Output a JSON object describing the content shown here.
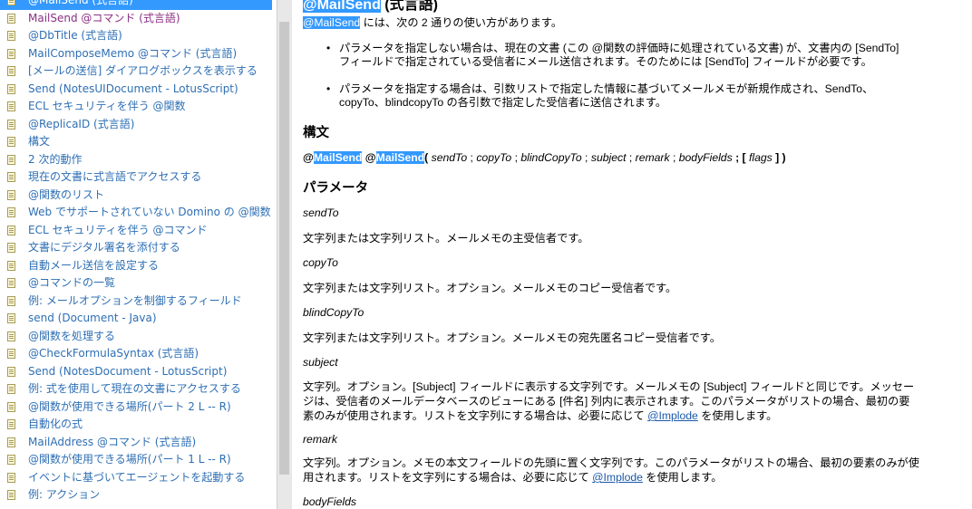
{
  "sidebar": {
    "items": [
      {
        "label": "@MailSend (式言語)",
        "state": "selected"
      },
      {
        "label": "MailSend @コマンド (式言語)",
        "state": "visited"
      },
      {
        "label": "@DbTitle (式言語)",
        "state": ""
      },
      {
        "label": "MailComposeMemo @コマンド (式言語)",
        "state": ""
      },
      {
        "label": "[メールの送信] ダイアログボックスを表示する",
        "state": ""
      },
      {
        "label": "Send (NotesUIDocument - LotusScript)",
        "state": ""
      },
      {
        "label": "ECL セキュリティを伴う @関数",
        "state": ""
      },
      {
        "label": "@ReplicaID (式言語)",
        "state": ""
      },
      {
        "label": "構文",
        "state": ""
      },
      {
        "label": "2 次的動作",
        "state": ""
      },
      {
        "label": "現在の文書に式言語でアクセスする",
        "state": ""
      },
      {
        "label": "@関数のリスト",
        "state": ""
      },
      {
        "label": "Web でサポートされていない Domino の @関数",
        "state": ""
      },
      {
        "label": "ECL セキュリティを伴う @コマンド",
        "state": ""
      },
      {
        "label": "文書にデジタル署名を添付する",
        "state": ""
      },
      {
        "label": "自動メール送信を設定する",
        "state": ""
      },
      {
        "label": "@コマンドの一覧",
        "state": ""
      },
      {
        "label": "例: メールオプションを制御するフィールド",
        "state": ""
      },
      {
        "label": "send (Document - Java)",
        "state": ""
      },
      {
        "label": "@関数を処理する",
        "state": ""
      },
      {
        "label": "@CheckFormulaSyntax (式言語)",
        "state": ""
      },
      {
        "label": "Send (NotesDocument - LotusScript)",
        "state": ""
      },
      {
        "label": "例: 式を使用して現在の文書にアクセスする",
        "state": ""
      },
      {
        "label": "@関数が使用できる場所(パート 2 L -- R)",
        "state": ""
      },
      {
        "label": "自動化の式",
        "state": ""
      },
      {
        "label": "MailAddress @コマンド (式言語)",
        "state": ""
      },
      {
        "label": "@関数が使用できる場所(パート 1 L -- R)",
        "state": ""
      },
      {
        "label": "イベントに基づいてエージェントを起動する",
        "state": ""
      },
      {
        "label": "例: アクション",
        "state": ""
      }
    ]
  },
  "article": {
    "title_hl": "@MailSend",
    "title_rest": " (式言語)",
    "intro_hl": "@MailSend",
    "intro_rest": " には、次の 2 通りの使い方があります。",
    "bullets": [
      "パラメータを指定しない場合は、現在の文書 (この @関数の評価時に処理されている文書) が、文書内の [SendTo] フィールドで指定されている受信者にメール送信されます。そのためには [SendTo] フィールドが必要です。",
      "パラメータを指定する場合は、引数リストで指定した情報に基づいてメールメモが新規作成され、SendTo、copyTo、blindcopyTo の各引数で指定した受信者に送信されます。"
    ],
    "syntax_heading": "構文",
    "syntax": {
      "at1": "@",
      "hl1": "MailSend",
      "at2": "@",
      "hl2": "MailSend",
      "open": "( ",
      "args": [
        "sendTo",
        "copyTo",
        "blindCopyTo",
        "subject",
        "remark",
        "bodyFields"
      ],
      "sep": " ; ",
      "opt_open": "; [ ",
      "flags": "flags",
      "close": " ] )"
    },
    "params_heading": "パラメータ",
    "params": [
      {
        "name": "sendTo",
        "desc": "文字列または文字列リスト。メールメモの主受信者です。"
      },
      {
        "name": "copyTo",
        "desc": "文字列または文字列リスト。オプション。メールメモのコピー受信者です。"
      },
      {
        "name": "blindCopyTo",
        "desc": "文字列または文字列リスト。オプション。メールメモの宛先匿名コピー受信者です。"
      },
      {
        "name": "subject",
        "desc_pre": "文字列。オプション。[Subject] フィールドに表示する文字列です。メールメモの [Subject] フィールドと同じです。メッセージは、受信者のメールデータベースのビューにある [件名] 列内に表示されます。このパラメータがリストの場合、最初の要素のみが使用されます。リストを文字列にする場合は、必要に応じて ",
        "link": "@Implode",
        "desc_post": " を使用します。"
      },
      {
        "name": "remark",
        "desc_pre": "文字列。オプション。メモの本文フィールドの先頭に置く文字列です。このパラメータがリストの場合、最初の要素のみが使用されます。リストを文字列にする場合は、必要に応じて ",
        "link": "@Implode",
        "desc_post": " を使用します。"
      },
      {
        "name": "bodyFields"
      }
    ]
  },
  "colors": {
    "link": "#2e6fb4",
    "visited": "#8b2f85",
    "selection": "#3399ff"
  }
}
